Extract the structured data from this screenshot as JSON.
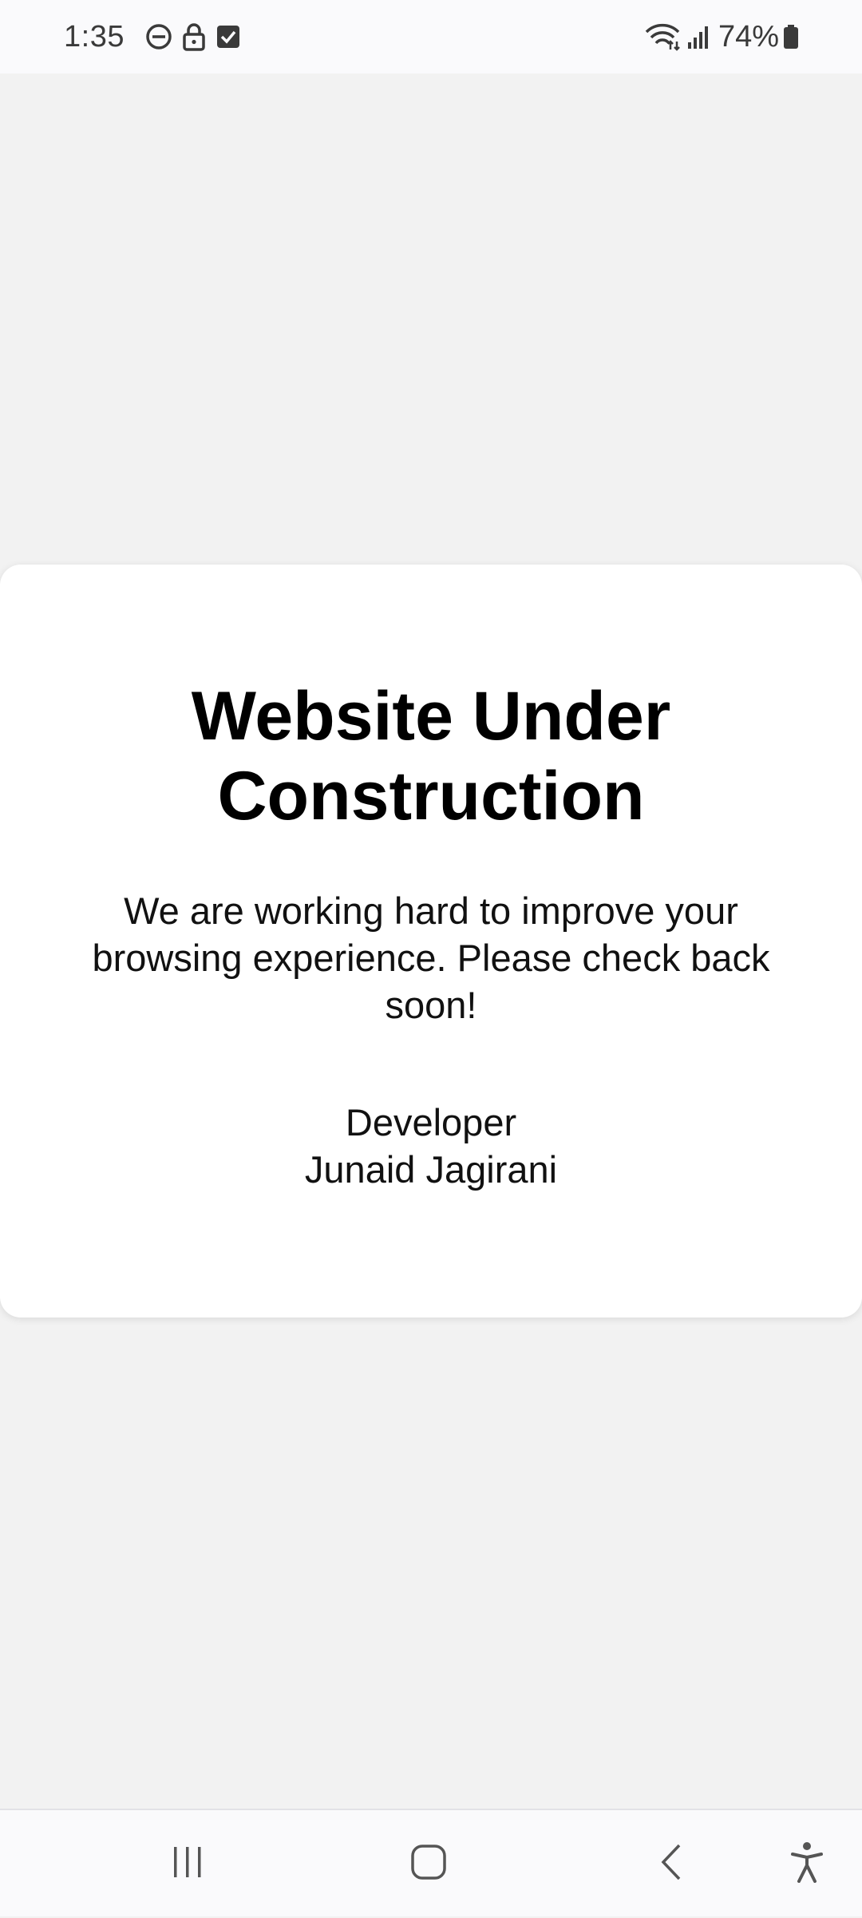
{
  "status_bar": {
    "time": "1:35",
    "battery_percent": "74%",
    "icons_left": [
      "do-not-disturb-icon",
      "lock-icon",
      "checkbox-icon"
    ],
    "icons_right": [
      "wifi-icon",
      "signal-icon",
      "battery-icon"
    ]
  },
  "card": {
    "title": "Website Under Construction",
    "message": "We are working hard to improve your browsing experience. Please check back soon!",
    "credit_role": "Developer",
    "credit_name": "Junaid Jagirani"
  },
  "nav_bar": {
    "buttons": [
      "recent-apps-icon",
      "home-icon",
      "back-icon",
      "accessibility-icon"
    ]
  },
  "colors": {
    "background": "#f2f2f2",
    "card": "#ffffff",
    "bars": "#fafafc",
    "text": "#000000"
  }
}
